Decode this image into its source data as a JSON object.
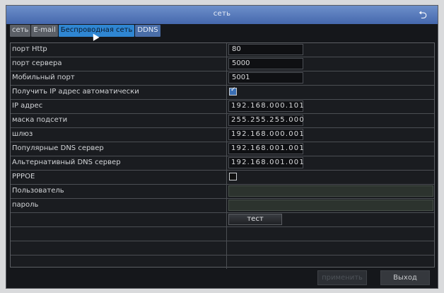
{
  "window": {
    "title": "сеть",
    "back_icon": "return-arrow-icon"
  },
  "tabs": [
    {
      "label": "сеть",
      "state": "normal"
    },
    {
      "label": "E-mail",
      "state": "normal"
    },
    {
      "label": "Беспроводная сеть",
      "state": "active"
    },
    {
      "label": "DDNS",
      "state": "highlight"
    }
  ],
  "rows": {
    "http_port": {
      "label": "порт Http",
      "value": "80"
    },
    "server_port": {
      "label": "порт сервера",
      "value": "5000"
    },
    "mobile_port": {
      "label": "Мобильный порт",
      "value": "5001"
    },
    "auto_ip": {
      "label": "Получить IP адрес автоматически",
      "checked": true
    },
    "ip": {
      "label": "IP адрес",
      "value": "192.168.000.101"
    },
    "mask": {
      "label": "маска подсети",
      "value": "255.255.255.000"
    },
    "gateway": {
      "label": "шлюз",
      "value": "192.168.000.001"
    },
    "dns1": {
      "label": "Популярные DNS сервер",
      "value": "192.168.001.001"
    },
    "dns2": {
      "label": "Альтернативный DNS сервер",
      "value": "192.168.001.001"
    },
    "pppoe": {
      "label": "PPPOE",
      "checked": false
    },
    "user": {
      "label": "Пользователь",
      "value": ""
    },
    "password": {
      "label": "пароль",
      "value": ""
    },
    "test": {
      "button_label": "тест"
    }
  },
  "footer": {
    "apply_label": "применить",
    "exit_label": "Выход"
  },
  "colors": {
    "titlebar": "#5a7cbf",
    "active_tab": "#2f86d2",
    "background": "#15171b"
  }
}
